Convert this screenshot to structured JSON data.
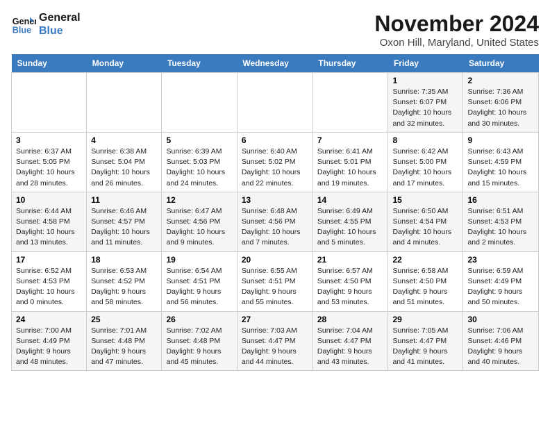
{
  "logo": {
    "line1": "General",
    "line2": "Blue"
  },
  "title": "November 2024",
  "subtitle": "Oxon Hill, Maryland, United States",
  "days_of_week": [
    "Sunday",
    "Monday",
    "Tuesday",
    "Wednesday",
    "Thursday",
    "Friday",
    "Saturday"
  ],
  "weeks": [
    [
      {
        "num": "",
        "info": ""
      },
      {
        "num": "",
        "info": ""
      },
      {
        "num": "",
        "info": ""
      },
      {
        "num": "",
        "info": ""
      },
      {
        "num": "",
        "info": ""
      },
      {
        "num": "1",
        "info": "Sunrise: 7:35 AM\nSunset: 6:07 PM\nDaylight: 10 hours and 32 minutes."
      },
      {
        "num": "2",
        "info": "Sunrise: 7:36 AM\nSunset: 6:06 PM\nDaylight: 10 hours and 30 minutes."
      }
    ],
    [
      {
        "num": "3",
        "info": "Sunrise: 6:37 AM\nSunset: 5:05 PM\nDaylight: 10 hours and 28 minutes."
      },
      {
        "num": "4",
        "info": "Sunrise: 6:38 AM\nSunset: 5:04 PM\nDaylight: 10 hours and 26 minutes."
      },
      {
        "num": "5",
        "info": "Sunrise: 6:39 AM\nSunset: 5:03 PM\nDaylight: 10 hours and 24 minutes."
      },
      {
        "num": "6",
        "info": "Sunrise: 6:40 AM\nSunset: 5:02 PM\nDaylight: 10 hours and 22 minutes."
      },
      {
        "num": "7",
        "info": "Sunrise: 6:41 AM\nSunset: 5:01 PM\nDaylight: 10 hours and 19 minutes."
      },
      {
        "num": "8",
        "info": "Sunrise: 6:42 AM\nSunset: 5:00 PM\nDaylight: 10 hours and 17 minutes."
      },
      {
        "num": "9",
        "info": "Sunrise: 6:43 AM\nSunset: 4:59 PM\nDaylight: 10 hours and 15 minutes."
      }
    ],
    [
      {
        "num": "10",
        "info": "Sunrise: 6:44 AM\nSunset: 4:58 PM\nDaylight: 10 hours and 13 minutes."
      },
      {
        "num": "11",
        "info": "Sunrise: 6:46 AM\nSunset: 4:57 PM\nDaylight: 10 hours and 11 minutes."
      },
      {
        "num": "12",
        "info": "Sunrise: 6:47 AM\nSunset: 4:56 PM\nDaylight: 10 hours and 9 minutes."
      },
      {
        "num": "13",
        "info": "Sunrise: 6:48 AM\nSunset: 4:56 PM\nDaylight: 10 hours and 7 minutes."
      },
      {
        "num": "14",
        "info": "Sunrise: 6:49 AM\nSunset: 4:55 PM\nDaylight: 10 hours and 5 minutes."
      },
      {
        "num": "15",
        "info": "Sunrise: 6:50 AM\nSunset: 4:54 PM\nDaylight: 10 hours and 4 minutes."
      },
      {
        "num": "16",
        "info": "Sunrise: 6:51 AM\nSunset: 4:53 PM\nDaylight: 10 hours and 2 minutes."
      }
    ],
    [
      {
        "num": "17",
        "info": "Sunrise: 6:52 AM\nSunset: 4:53 PM\nDaylight: 10 hours and 0 minutes."
      },
      {
        "num": "18",
        "info": "Sunrise: 6:53 AM\nSunset: 4:52 PM\nDaylight: 9 hours and 58 minutes."
      },
      {
        "num": "19",
        "info": "Sunrise: 6:54 AM\nSunset: 4:51 PM\nDaylight: 9 hours and 56 minutes."
      },
      {
        "num": "20",
        "info": "Sunrise: 6:55 AM\nSunset: 4:51 PM\nDaylight: 9 hours and 55 minutes."
      },
      {
        "num": "21",
        "info": "Sunrise: 6:57 AM\nSunset: 4:50 PM\nDaylight: 9 hours and 53 minutes."
      },
      {
        "num": "22",
        "info": "Sunrise: 6:58 AM\nSunset: 4:50 PM\nDaylight: 9 hours and 51 minutes."
      },
      {
        "num": "23",
        "info": "Sunrise: 6:59 AM\nSunset: 4:49 PM\nDaylight: 9 hours and 50 minutes."
      }
    ],
    [
      {
        "num": "24",
        "info": "Sunrise: 7:00 AM\nSunset: 4:49 PM\nDaylight: 9 hours and 48 minutes."
      },
      {
        "num": "25",
        "info": "Sunrise: 7:01 AM\nSunset: 4:48 PM\nDaylight: 9 hours and 47 minutes."
      },
      {
        "num": "26",
        "info": "Sunrise: 7:02 AM\nSunset: 4:48 PM\nDaylight: 9 hours and 45 minutes."
      },
      {
        "num": "27",
        "info": "Sunrise: 7:03 AM\nSunset: 4:47 PM\nDaylight: 9 hours and 44 minutes."
      },
      {
        "num": "28",
        "info": "Sunrise: 7:04 AM\nSunset: 4:47 PM\nDaylight: 9 hours and 43 minutes."
      },
      {
        "num": "29",
        "info": "Sunrise: 7:05 AM\nSunset: 4:47 PM\nDaylight: 9 hours and 41 minutes."
      },
      {
        "num": "30",
        "info": "Sunrise: 7:06 AM\nSunset: 4:46 PM\nDaylight: 9 hours and 40 minutes."
      }
    ]
  ]
}
